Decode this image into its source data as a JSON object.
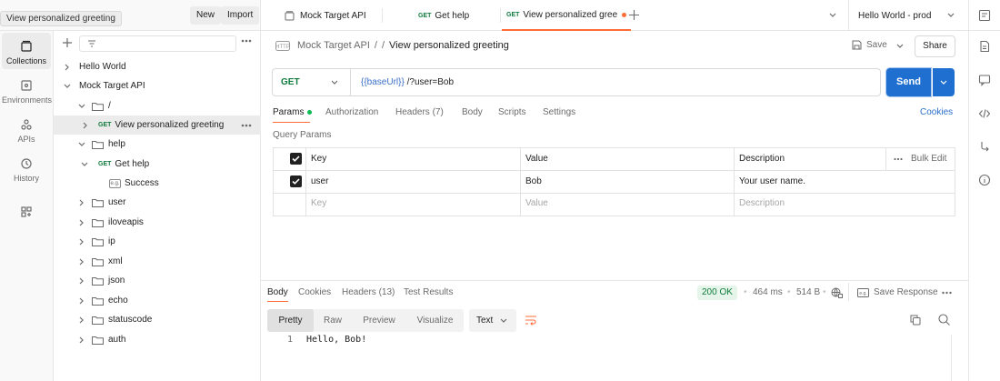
{
  "header": {
    "tooltip": "View personalized greeting",
    "new_label": "New",
    "import_label": "Import"
  },
  "rail": {
    "items": [
      {
        "label": "Collections",
        "icon": "collections-icon",
        "active": true
      },
      {
        "label": "Environments",
        "icon": "environments-icon"
      },
      {
        "label": "APIs",
        "icon": "apis-icon"
      },
      {
        "label": "History",
        "icon": "history-icon"
      }
    ]
  },
  "tree": [
    {
      "label": "Hello World",
      "type": "collection",
      "depth": 0
    },
    {
      "label": "Mock Target API",
      "type": "collection",
      "depth": 0,
      "expanded": true
    },
    {
      "label": "/",
      "type": "folder",
      "depth": 1,
      "expanded": true
    },
    {
      "label": "View personalized greeting",
      "type": "request",
      "method": "GET",
      "depth": 2,
      "selected": true
    },
    {
      "label": "help",
      "type": "folder",
      "depth": 1,
      "expanded": true
    },
    {
      "label": "Get help",
      "type": "request",
      "method": "GET",
      "depth": 2,
      "expanded": true
    },
    {
      "label": "Success",
      "type": "example",
      "depth": 3,
      "badge": "e.g."
    },
    {
      "label": "user",
      "type": "folder",
      "depth": 1
    },
    {
      "label": "iloveapis",
      "type": "folder",
      "depth": 1
    },
    {
      "label": "ip",
      "type": "folder",
      "depth": 1
    },
    {
      "label": "xml",
      "type": "folder",
      "depth": 1
    },
    {
      "label": "json",
      "type": "folder",
      "depth": 1
    },
    {
      "label": "echo",
      "type": "folder",
      "depth": 1
    },
    {
      "label": "statuscode",
      "type": "folder",
      "depth": 1
    },
    {
      "label": "auth",
      "type": "folder",
      "depth": 1
    }
  ],
  "tabs": [
    {
      "label": "Mock Target API",
      "icon": "collection-icon"
    },
    {
      "method": "GET",
      "label": "Get help"
    },
    {
      "method": "GET",
      "label": "View personalized gree",
      "active": true,
      "unsaved": true
    }
  ],
  "environment": "Hello World - prod",
  "breadcrumb": {
    "parts": [
      "Mock Target API",
      "/",
      "/"
    ],
    "current": "View personalized greeting"
  },
  "request": {
    "save_label": "Save",
    "share_label": "Share",
    "method": "GET",
    "url_var": "{{baseUrl}}",
    "url_rest": " /?user=Bob",
    "send_label": "Send",
    "tabs": [
      {
        "label": "Params",
        "active": true,
        "dot": true
      },
      {
        "label": "Authorization"
      },
      {
        "label": "Headers (7)"
      },
      {
        "label": "Body"
      },
      {
        "label": "Scripts"
      },
      {
        "label": "Settings"
      }
    ],
    "cookies_label": "Cookies",
    "query_params_label": "Query Params",
    "table": {
      "headers": [
        "Key",
        "Value",
        "Description"
      ],
      "bulk_edit_label": "Bulk Edit",
      "rows": [
        {
          "key": "user",
          "value": "Bob",
          "description": "Your user name.",
          "checked": true
        }
      ],
      "placeholder": {
        "key": "Key",
        "value": "Value",
        "description": "Description"
      }
    }
  },
  "response": {
    "tabs": [
      {
        "label": "Body",
        "active": true
      },
      {
        "label": "Cookies"
      },
      {
        "label": "Headers (13)"
      },
      {
        "label": "Test Results"
      }
    ],
    "status": "200 OK",
    "time": "464 ms",
    "size": "514 B",
    "save_label": "Save Response",
    "formats": [
      "Pretty",
      "Raw",
      "Preview",
      "Visualize"
    ],
    "language": "Text",
    "lines": [
      {
        "num": "1",
        "text": "Hello, Bob!"
      }
    ]
  },
  "colors": {
    "accent": "#ff6c37",
    "send": "#1f6fd1",
    "get_method": "#0f7b3c",
    "status_ok": "#0f7b3c",
    "var_blue": "#3b6ec9",
    "link_blue": "#2a6fc9"
  }
}
